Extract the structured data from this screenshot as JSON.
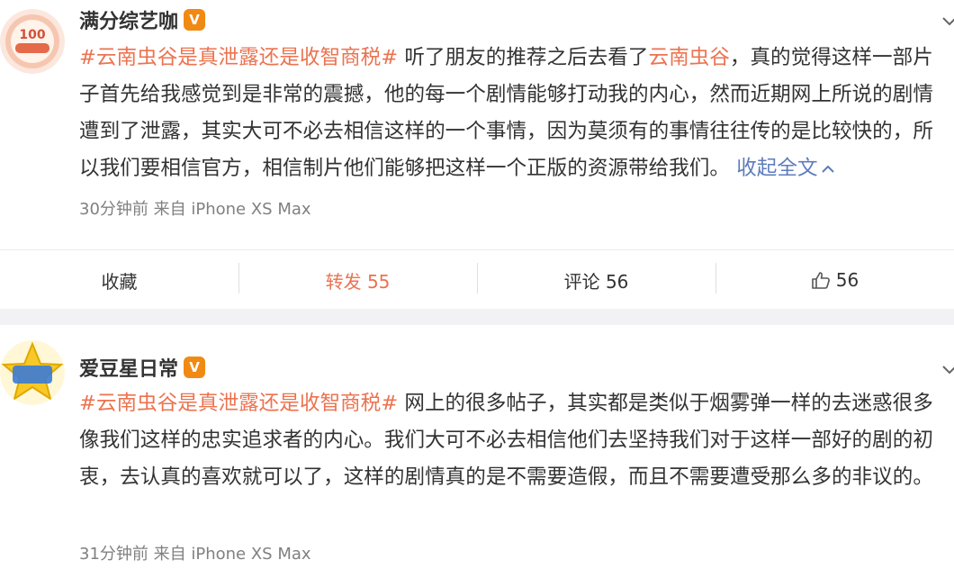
{
  "colors": {
    "topic": "#eb7350",
    "link": "#5d7cbc",
    "meta": "#808080",
    "vip_badge": "#f08a12"
  },
  "posts": [
    {
      "author": "满分综艺咖",
      "badge": "V",
      "topic_tag": "#云南虫谷是真泄露还是收智商税#",
      "text_a": " 听了朋友的推荐之后去看了",
      "inline_topic": "云南虫谷",
      "text_b": "，真的觉得这样一部片子首先给我感觉到是非常的震撼，他的每一个剧情能够打动我的内心，然而近期网上所说的剧情遭到了泄露，其实大可不必去相信这样的一个事情，因为莫须有的事情往往传的是比较快的，所以我们要相信官方，相信制片他们能够把这样一个正版的资源带给我们。 ",
      "collapse_label": "收起全文",
      "time": "30分钟前",
      "source": "来自 iPhone XS Max",
      "actions": {
        "favorite": "收藏",
        "repost": "转发 55",
        "comment": "评论 56",
        "like": "56"
      }
    },
    {
      "author": "爱豆星日常",
      "badge": "V",
      "topic_tag": "#云南虫谷是真泄露还是收智商税#",
      "text": " 网上的很多帖子，其实都是类似于烟雾弹一样的去迷惑很多像我们这样的忠实追求者的内心。我们大可不必去相信他们去坚持我们对于这样一部好的剧的初衷，去认真的喜欢就可以了，这样的剧情真的是不需要造假，而且不需要遭受那么多的非议的。",
      "time": "31分钟前",
      "source": "来自 iPhone XS Max"
    }
  ]
}
